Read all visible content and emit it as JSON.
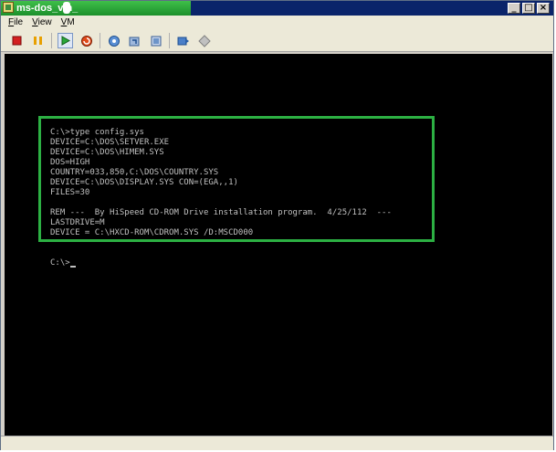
{
  "window": {
    "title": "ms-dos_vm_"
  },
  "menu": {
    "items": [
      {
        "label": "File",
        "accel": "F",
        "rest": "ile"
      },
      {
        "label": "View",
        "accel": "V",
        "rest": "iew"
      },
      {
        "label": "VM",
        "accel": "V",
        "rest": "M"
      }
    ]
  },
  "caption_buttons": {
    "minimize": "_",
    "maximize": "□",
    "close": "×"
  },
  "toolbar": {
    "icons": [
      "stop-icon",
      "pause-icon",
      "start-icon",
      "reset-icon",
      "snapshot-icon",
      "revert-icon",
      "manage-snapshots-icon",
      "ctrl-alt-del-icon",
      "settings-icon"
    ]
  },
  "console": {
    "lines": [
      "C:\\>type config.sys",
      "DEVICE=C:\\DOS\\SETVER.EXE",
      "DEVICE=C:\\DOS\\HIMEM.SYS",
      "DOS=HIGH",
      "COUNTRY=033,850,C:\\DOS\\COUNTRY.SYS",
      "DEVICE=C:\\DOS\\DISPLAY.SYS CON=(EGA,,1)",
      "FILES=30",
      "",
      "REM ---  By HiSpeed CD-ROM Drive installation program.  4/25/112  ---",
      "LASTDRIVE=M",
      "DEVICE = C:\\HXCD-ROM\\CDROM.SYS /D:MSCD000",
      "",
      "",
      "C:\\>"
    ]
  },
  "colors": {
    "title_bar": "#0a246a",
    "title_highlight": "#2aa83a",
    "screen_background": "#000000",
    "console_text": "#c0c0c0",
    "highlight_box": "#2cb043"
  }
}
